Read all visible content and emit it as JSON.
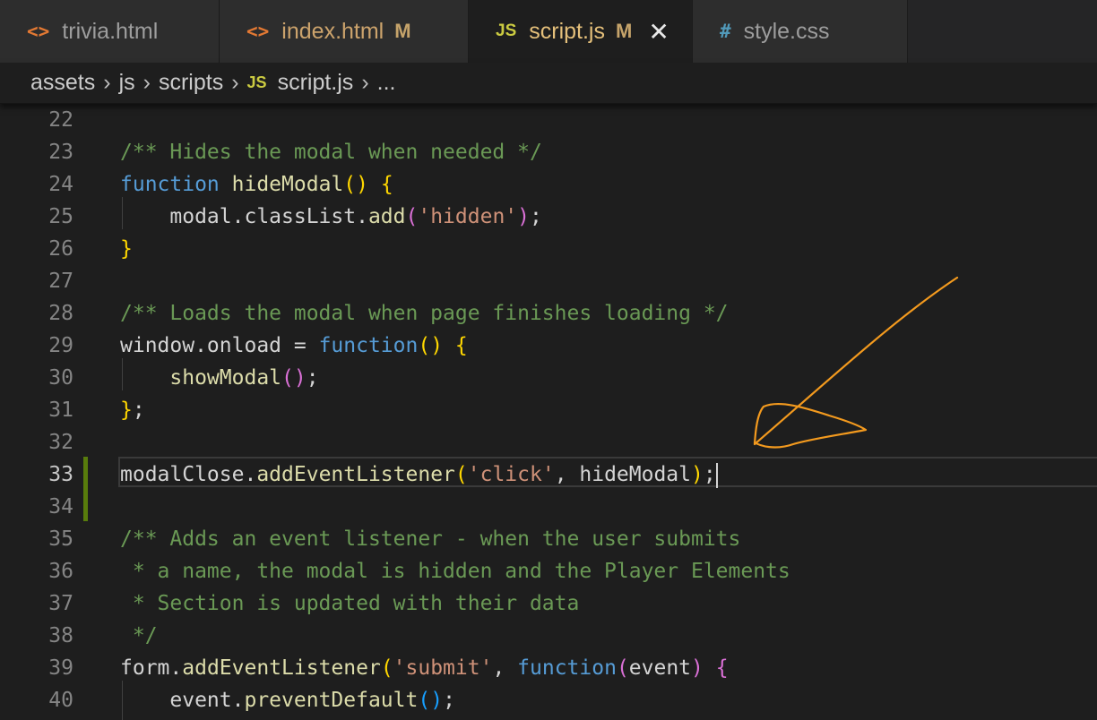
{
  "tabs": [
    {
      "icon": "<>",
      "label": "trivia.html",
      "modified": "",
      "active": false
    },
    {
      "icon": "<>",
      "label": "index.html",
      "modified": "M",
      "active": false
    },
    {
      "icon": "JS",
      "label": "script.js",
      "modified": "M",
      "active": true
    },
    {
      "icon": "#",
      "label": "style.css",
      "modified": "",
      "active": false
    }
  ],
  "breadcrumb": {
    "items": [
      "assets",
      "js",
      "scripts",
      "script.js",
      "..."
    ],
    "js_icon": "JS"
  },
  "editor": {
    "line_numbers": [
      "22",
      "23",
      "24",
      "25",
      "26",
      "27",
      "28",
      "29",
      "30",
      "31",
      "32",
      "33",
      "34",
      "35",
      "36",
      "37",
      "38",
      "39",
      "40"
    ],
    "current_line": "33",
    "lines": [
      "",
      "/** Hides the modal when needed */",
      "function hideModal() {",
      "    modal.classList.add('hidden');",
      "}",
      "",
      "/** Loads the modal when page finishes loading */",
      "window.onload = function() {",
      "    showModal();",
      "};",
      "",
      "modalClose.addEventListener('click', hideModal);",
      "",
      "/** Adds an event listener - when the user submits",
      " * a name, the modal is hidden and the Player Elements",
      " * Section is updated with their data",
      " */",
      "form.addEventListener('submit', function(event) {",
      "    event.preventDefault();"
    ]
  },
  "colors": {
    "annotation": "#f39a1e",
    "comment": "#6a9955",
    "keyword": "#569cd6",
    "string": "#ce9178",
    "git_modified": "#587c0c"
  }
}
